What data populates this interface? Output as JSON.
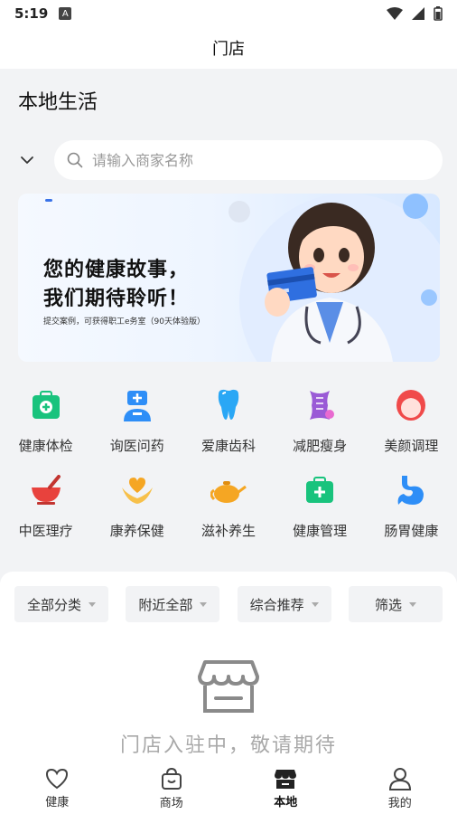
{
  "status_bar": {
    "time": "5:19",
    "badge": "A"
  },
  "nav": {
    "title": "门店"
  },
  "section": {
    "title": "本地生活"
  },
  "search": {
    "placeholder": "请输入商家名称"
  },
  "banner": {
    "line1": "您的健康故事，",
    "line2": "我们期待聆听！",
    "subtitle": "提交案例，可获得职工e务室（90天体验版）"
  },
  "categories": [
    {
      "label": "健康体检",
      "icon": "medical-kit-icon",
      "color": "#19c37d"
    },
    {
      "label": "询医问药",
      "icon": "doctor-icon",
      "color": "#2e8ef7"
    },
    {
      "label": "爱康齿科",
      "icon": "tooth-icon",
      "color": "#2aa7f5"
    },
    {
      "label": "减肥瘦身",
      "icon": "corset-icon",
      "color": "#9a5ad6"
    },
    {
      "label": "美颜调理",
      "icon": "face-icon",
      "color": "#f04a4a"
    },
    {
      "label": "中医理疗",
      "icon": "mortar-icon",
      "color": "#e8423d"
    },
    {
      "label": "康养保健",
      "icon": "heart-hands-icon",
      "color": "#f5a623"
    },
    {
      "label": "滋补养生",
      "icon": "teapot-icon",
      "color": "#f5a623"
    },
    {
      "label": "健康管理",
      "icon": "health-bag-icon",
      "color": "#19c37d"
    },
    {
      "label": "肠胃健康",
      "icon": "stomach-icon",
      "color": "#2e8ef7"
    }
  ],
  "filters": [
    {
      "label": "全部分类"
    },
    {
      "label": "附近全部"
    },
    {
      "label": "综合推荐"
    },
    {
      "label": "筛选"
    }
  ],
  "empty_state": {
    "text": "门店入驻中，敬请期待"
  },
  "tabs": [
    {
      "label": "健康",
      "icon": "heart-outline-icon",
      "active": false
    },
    {
      "label": "商场",
      "icon": "shopping-bag-icon",
      "active": false
    },
    {
      "label": "本地",
      "icon": "store-icon",
      "active": true
    },
    {
      "label": "我的",
      "icon": "person-icon",
      "active": false
    }
  ]
}
